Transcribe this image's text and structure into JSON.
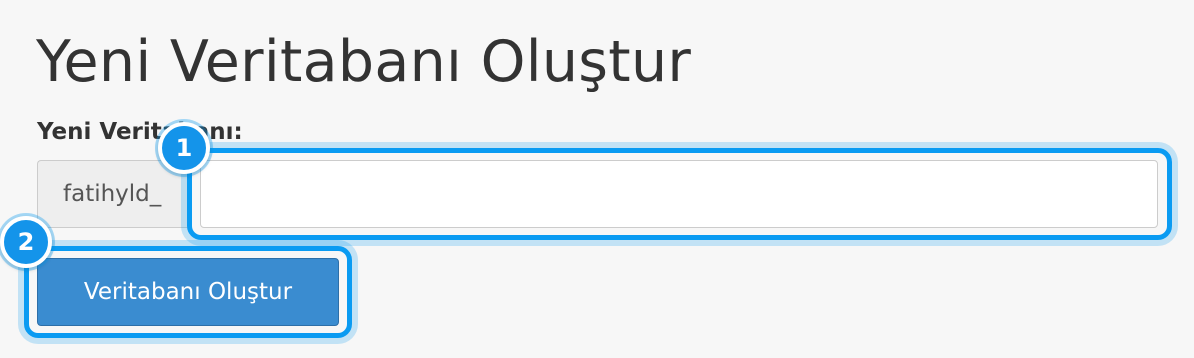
{
  "page": {
    "title": "Yeni Veritabanı Oluştur"
  },
  "form": {
    "field_label": "Yeni Veritabanı:",
    "prefix": "fatihyld_",
    "input_value": "",
    "submit_label": "Veritabanı Oluştur"
  },
  "annotations": {
    "step_1": "1",
    "step_2": "2"
  },
  "colors": {
    "highlight": "#0a9bf2",
    "button": "#3a8cd0",
    "background": "#f7f7f7"
  }
}
